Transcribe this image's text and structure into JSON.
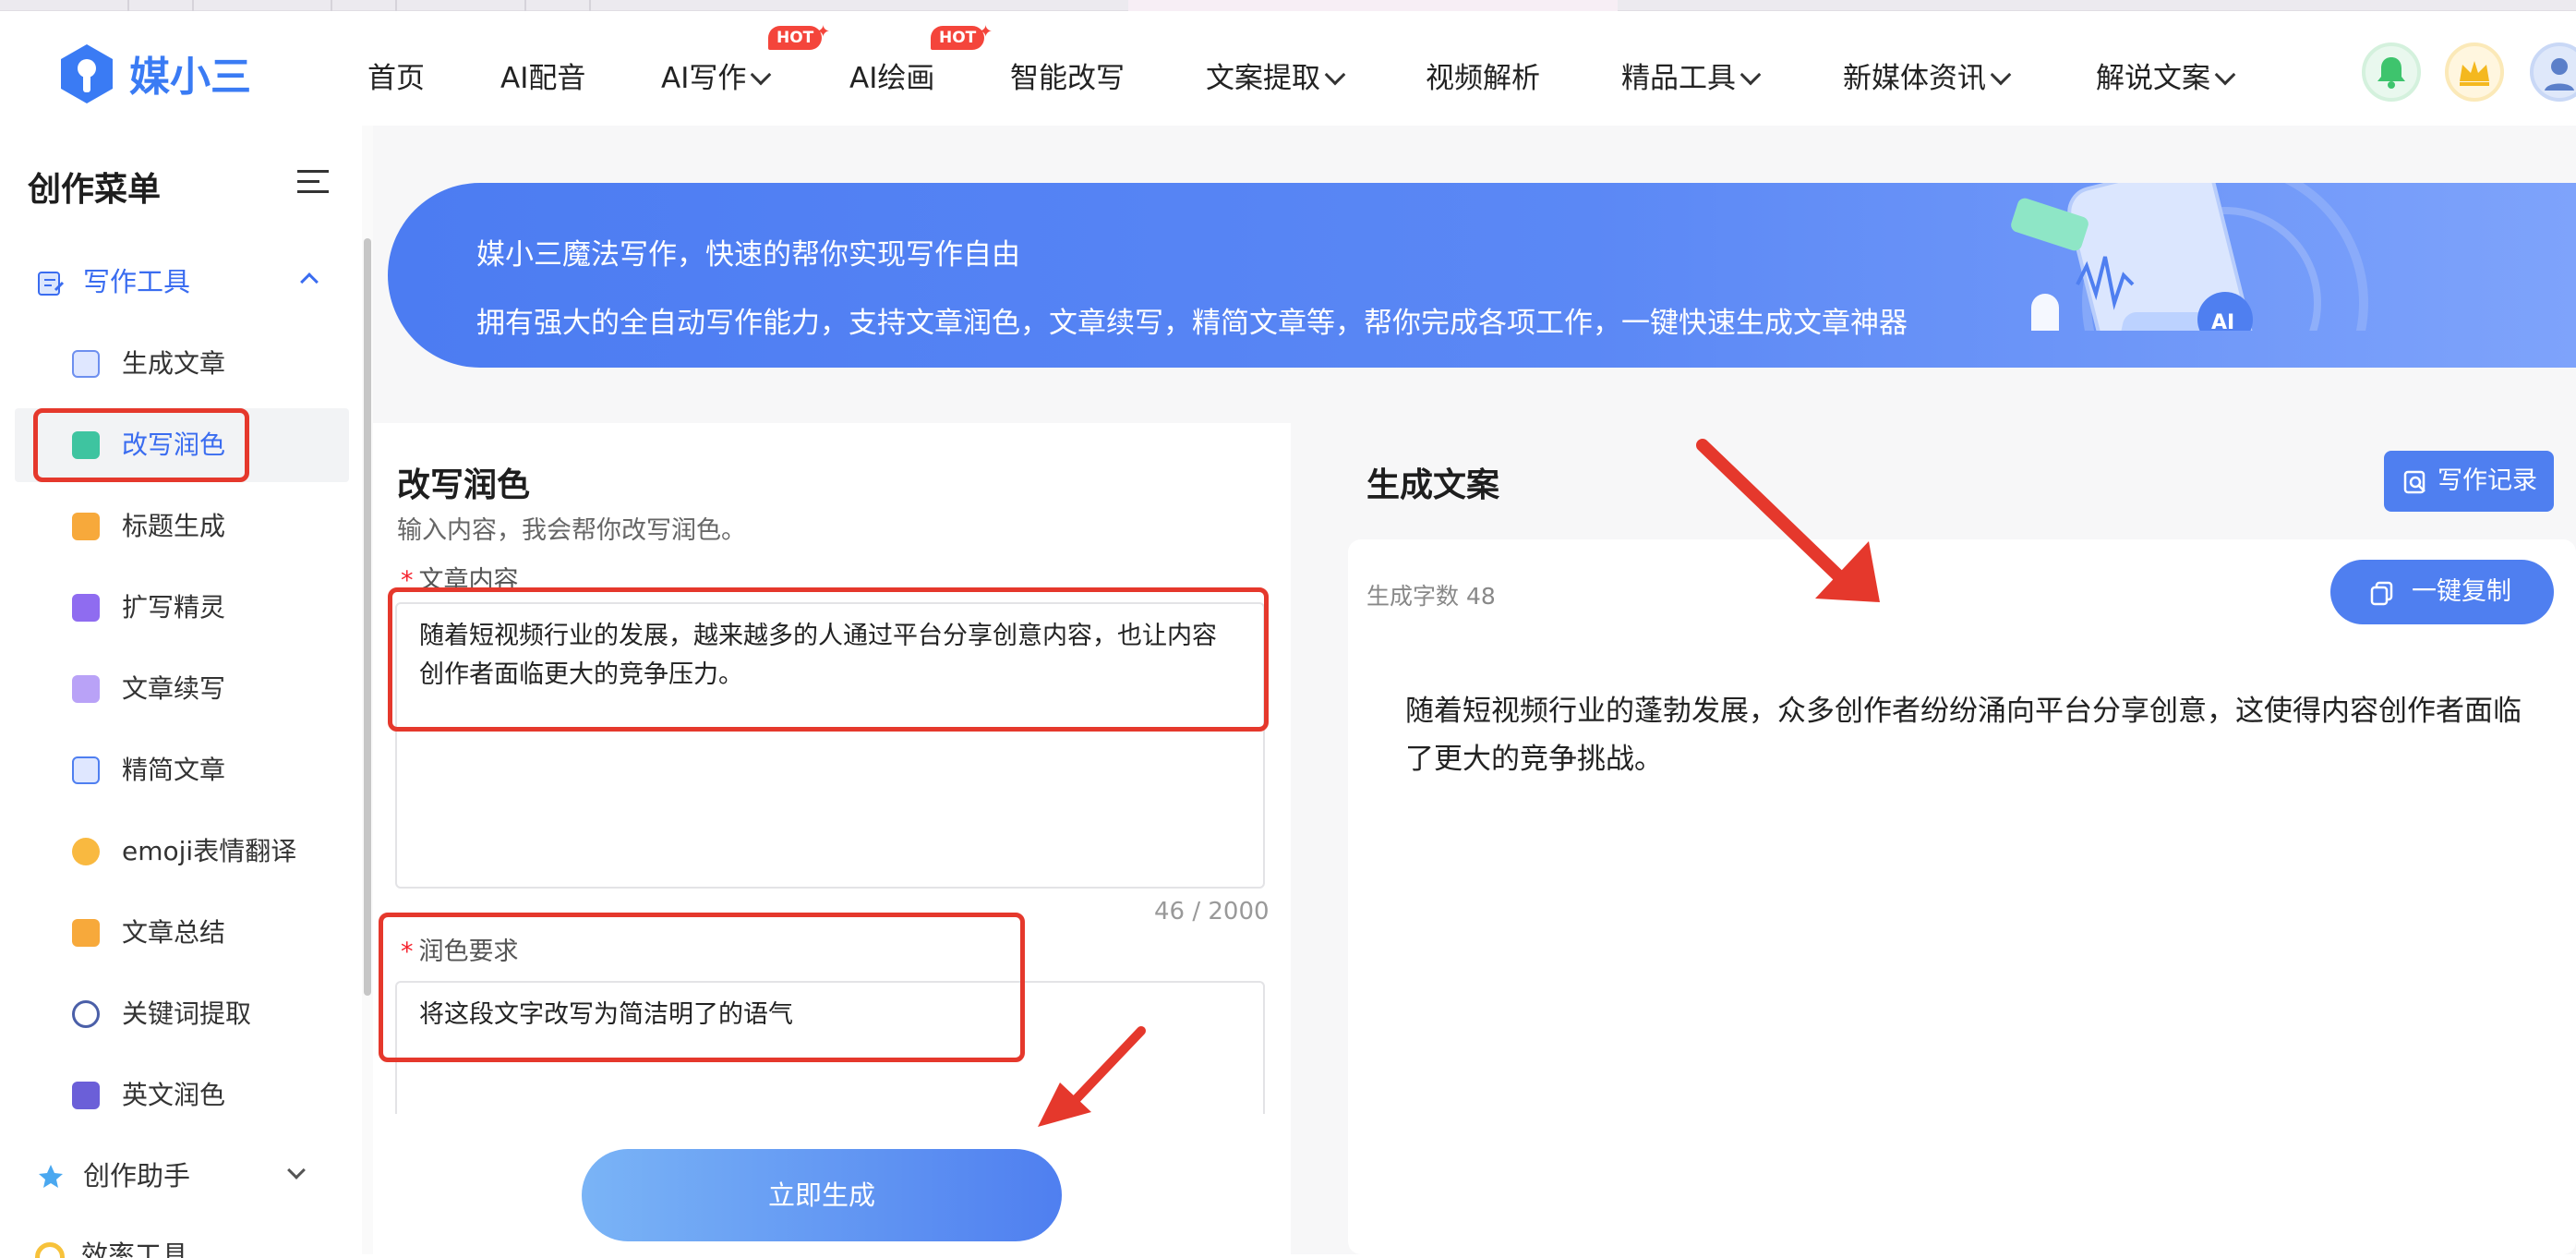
{
  "app": {
    "brand": "媒小三"
  },
  "nav": {
    "items": [
      {
        "label": "首页"
      },
      {
        "label": "AI配音"
      },
      {
        "label": "AI写作",
        "badge": "HOT"
      },
      {
        "label": "AI绘画",
        "badge": "HOT"
      },
      {
        "label": "智能改写"
      },
      {
        "label": "文案提取"
      },
      {
        "label": "视频解析"
      },
      {
        "label": "精品工具"
      },
      {
        "label": "新媒体资讯"
      },
      {
        "label": "解说文案"
      }
    ],
    "icons": [
      "bell-icon",
      "crown-icon",
      "user-avatar"
    ]
  },
  "sidebar": {
    "title": "创作菜单",
    "group1": {
      "label": "写作工具"
    },
    "items": [
      {
        "label": "生成文章"
      },
      {
        "label": "改写润色"
      },
      {
        "label": "标题生成"
      },
      {
        "label": "扩写精灵"
      },
      {
        "label": "文章续写"
      },
      {
        "label": "精简文章"
      },
      {
        "label": "emoji表情翻译"
      },
      {
        "label": "文章总结"
      },
      {
        "label": "关键词提取"
      },
      {
        "label": "英文润色"
      }
    ],
    "group2": {
      "label": "创作助手"
    },
    "group3": {
      "label": "效率工具"
    }
  },
  "banner": {
    "line1": "媒小三魔法写作，快速的帮你实现写作自由",
    "line2": "拥有强大的全自动写作能力，支持文章润色，文章续写，精简文章等，帮你完成各项工作，一键快速生成文章神器"
  },
  "form": {
    "title": "改写润色",
    "subtitle": "输入内容，我会帮你改写润色。",
    "content_label": "文章内容",
    "content_value": "随着短视频行业的发展，越来越多的人通过平台分享创意内容，也让内容创作者面临更大的竞争压力。",
    "counter": "46 / 2000",
    "req_label": "润色要求",
    "req_value": "将这段文字改写为简洁明了的语气",
    "submit_label": "立即生成"
  },
  "result": {
    "title": "生成文案",
    "history_label": "写作记录",
    "count_label": "生成字数 48",
    "copy_label": "一键复制",
    "text": "随着短视频行业的蓬勃发展，众多创作者纷纷涌向平台分享创意，这使得内容创作者面临了更大的竞争挑战。"
  },
  "colors": {
    "accent": "#4f7ff0",
    "highlight": "#e5382c",
    "hot": "#f4453b"
  }
}
